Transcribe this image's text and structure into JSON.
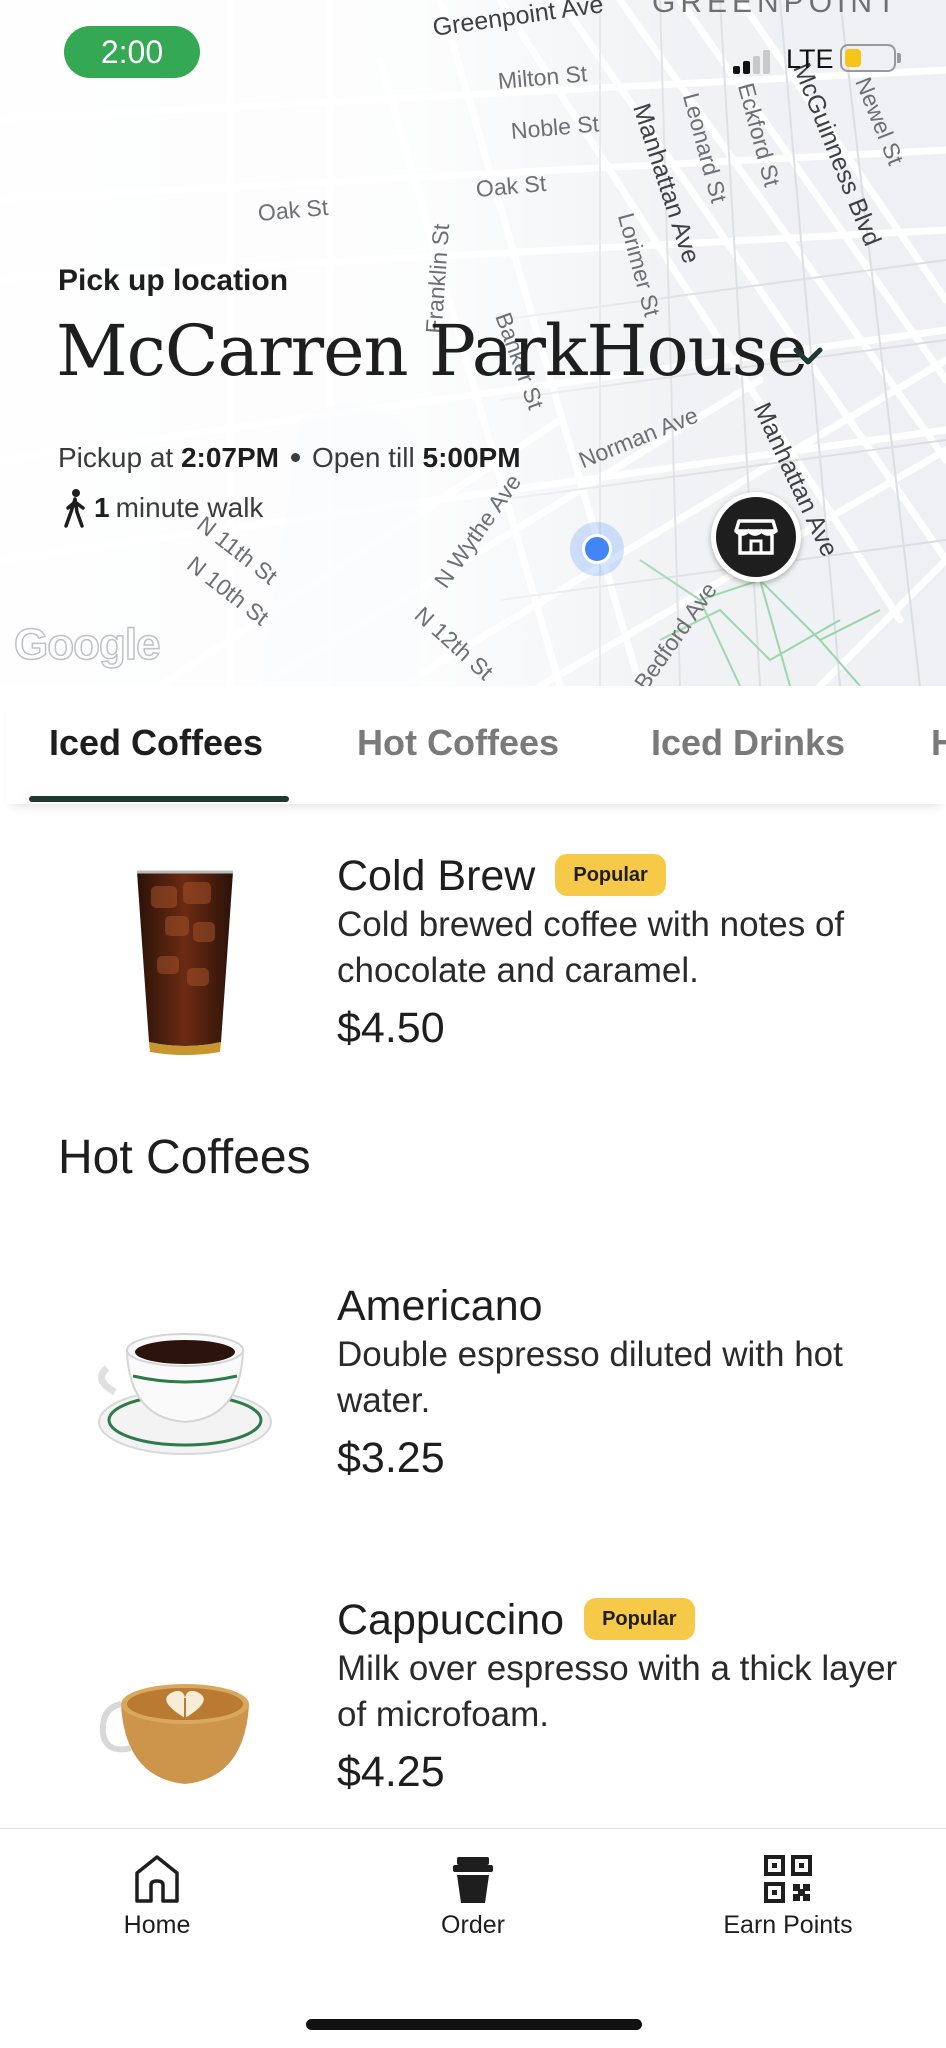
{
  "status_bar": {
    "time": "2:00",
    "network": "LTE"
  },
  "map": {
    "attribution": "Google",
    "area_label": "GREENPOINT",
    "streets": {
      "greenpoint_ave": "Greenpoint Ave",
      "milton_st": "Milton St",
      "noble_st": "Noble St",
      "oak_st_1": "Oak St",
      "oak_st_2": "Oak St",
      "franklin_st": "Franklin St",
      "manhattan_ave_1": "Manhattan Ave",
      "manhattan_ave_2": "Manhattan Ave",
      "lorimer_st": "Lorimer St",
      "leonard_st": "Leonard St",
      "eckford_st": "Eckford St",
      "mcguinness_blvd": "McGuinness Blvd",
      "newel_st": "Newel St",
      "banker_st": "Banker St",
      "norman_ave": "Norman Ave",
      "n_wythe_ave": "N Wythe Ave",
      "n_12th_st": "N 12th St",
      "n_10th_st": "N 10th St",
      "n_11th_st": "N 11th St",
      "bedford_ave": "Bedford Ave"
    }
  },
  "location": {
    "label": "Pick up location",
    "store_name": "McCarren ParkHouse",
    "pickup_prefix": "Pickup at",
    "pickup_time": "2:07PM",
    "open_prefix": "Open till",
    "open_time": "5:00PM",
    "walk_count": "1",
    "walk_text": "minute walk"
  },
  "tabs": [
    {
      "label": "Iced Coffees",
      "active": true
    },
    {
      "label": "Hot Coffees",
      "active": false
    },
    {
      "label": "Iced Drinks",
      "active": false
    },
    {
      "label": "H",
      "active": false
    }
  ],
  "menu": {
    "items": [
      {
        "name": "Cold Brew",
        "badge": "Popular",
        "description": "Cold brewed coffee with notes of chocolate and caramel.",
        "price": "$4.50"
      },
      {
        "name": "Americano",
        "badge": "",
        "description": "Double espresso diluted with hot water.",
        "price": "$3.25"
      },
      {
        "name": "Cappuccino",
        "badge": "Popular",
        "description": "Milk over espresso with a thick layer of microfoam.",
        "price": "$4.25"
      }
    ],
    "section_hot": "Hot Coffees"
  },
  "bottom_nav": {
    "items": [
      {
        "label": "Home",
        "icon": "home-icon"
      },
      {
        "label": "Order",
        "icon": "cup-icon"
      },
      {
        "label": "Earn Points",
        "icon": "qr-code-icon"
      }
    ]
  },
  "colors": {
    "accent": "#1e3932",
    "badge": "#f7c948",
    "status_pill": "#34a853",
    "user_location": "#4285f4"
  }
}
